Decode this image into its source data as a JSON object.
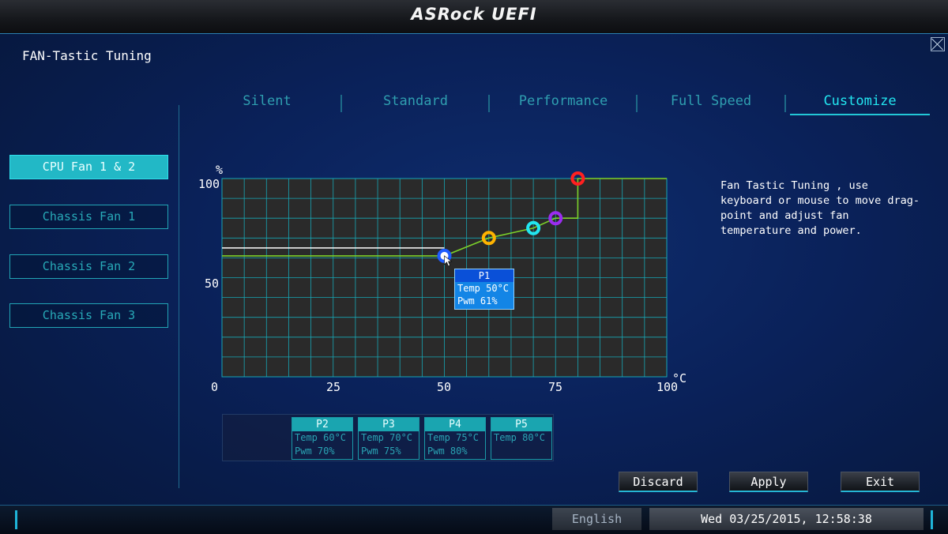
{
  "header": {
    "logo": "ASRock UEFI"
  },
  "page": {
    "title": "FAN-Tastic Tuning"
  },
  "tabs": [
    {
      "label": "Silent",
      "active": false
    },
    {
      "label": "Standard",
      "active": false
    },
    {
      "label": "Performance",
      "active": false
    },
    {
      "label": "Full Speed",
      "active": false
    },
    {
      "label": "Customize",
      "active": true
    }
  ],
  "fans": [
    {
      "label": "CPU Fan 1 & 2",
      "active": true
    },
    {
      "label": "Chassis Fan 1",
      "active": false
    },
    {
      "label": "Chassis Fan 2",
      "active": false
    },
    {
      "label": "Chassis Fan 3",
      "active": false
    }
  ],
  "chart_data": {
    "type": "line",
    "x_unit": "°C",
    "y_unit": "%",
    "xlim": [
      0,
      100
    ],
    "ylim": [
      0,
      100
    ],
    "x_ticks": [
      "0",
      "25",
      "50",
      "75",
      "100"
    ],
    "y_ticks": [
      "100",
      "50",
      "0"
    ],
    "grid": true,
    "curve": [
      [
        0,
        61
      ],
      [
        50,
        61
      ],
      [
        60,
        70
      ],
      [
        70,
        75
      ],
      [
        75,
        80
      ],
      [
        80,
        80
      ],
      [
        80,
        100
      ],
      [
        100,
        100
      ]
    ],
    "drag_line": {
      "y": 65,
      "x_end": 50
    },
    "points": [
      {
        "name": "P1",
        "temp": 50,
        "pwm": 61,
        "color": "#1e5cff",
        "selected": true
      },
      {
        "name": "P2",
        "temp": 60,
        "pwm": 70,
        "color": "#ffb300"
      },
      {
        "name": "P3",
        "temp": 70,
        "pwm": 75,
        "color": "#22e6f0"
      },
      {
        "name": "P4",
        "temp": 75,
        "pwm": 80,
        "color": "#9b2cf0"
      },
      {
        "name": "P5",
        "temp": 80,
        "pwm": 100,
        "color": "#ff2020"
      }
    ],
    "colors": {
      "curve": "#7cd12a",
      "grid": "#17a6b5",
      "plot_bg": "#2a2a2a"
    }
  },
  "tooltip": {
    "title": "P1",
    "temp": "Temp 50°C",
    "pwm": "Pwm  61%"
  },
  "point_boxes": [
    {
      "title": "P2",
      "temp": "Temp 60°C",
      "pwm": "Pwm  70%"
    },
    {
      "title": "P3",
      "temp": "Temp 70°C",
      "pwm": "Pwm  75%"
    },
    {
      "title": "P4",
      "temp": "Temp 75°C",
      "pwm": "Pwm  80%"
    },
    {
      "title": "P5",
      "temp": "Temp 80°C",
      "pwm": ""
    }
  ],
  "help_text": "Fan Tastic Tuning , use keyboard or mouse to move drag-point and adjust fan temperature and power.",
  "buttons": {
    "discard": "Discard",
    "apply": "Apply",
    "exit": "Exit"
  },
  "status": {
    "language": "English",
    "datetime": "Wed 03/25/2015, 12:58:38"
  }
}
